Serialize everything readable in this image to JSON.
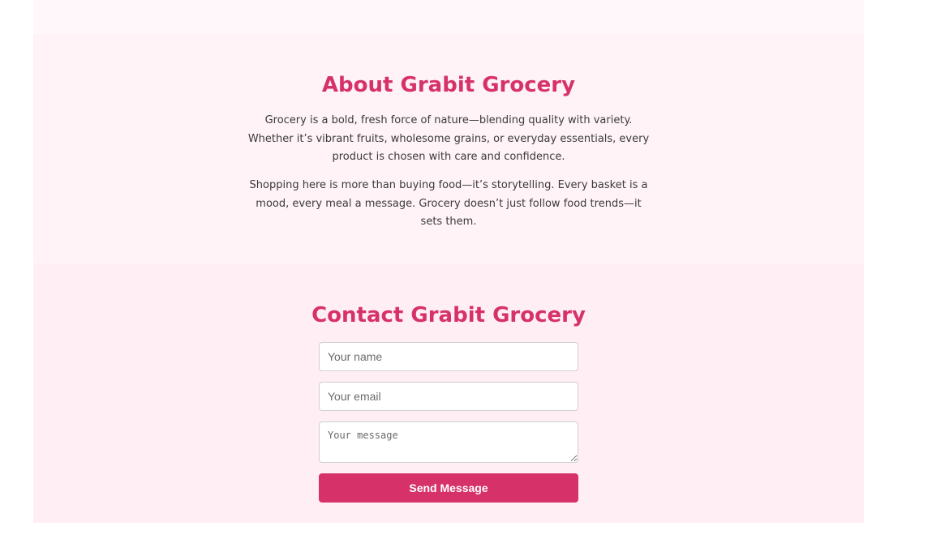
{
  "about": {
    "title": "About Grabit Grocery",
    "paragraph_1": "Grocery is a bold, fresh force of nature—blending quality with variety. Whether it’s vibrant fruits, wholesome grains, or everyday essentials, every product is chosen with care and confidence.",
    "paragraph_2": "Shopping here is more than buying food—it’s storytelling. Every basket is a mood, every meal a message. Grocery doesn’t just follow food trends—it sets them."
  },
  "contact": {
    "title": "Contact Grabit Grocery",
    "name_placeholder": "Your name",
    "name_value": "",
    "email_placeholder": "Your email",
    "email_value": "",
    "message_placeholder": "Your message",
    "message_value": "",
    "send_label": "Send Message"
  },
  "colors": {
    "accent": "#d63269",
    "about_background": "#fff3f7",
    "contact_background": "#ffeff4"
  }
}
